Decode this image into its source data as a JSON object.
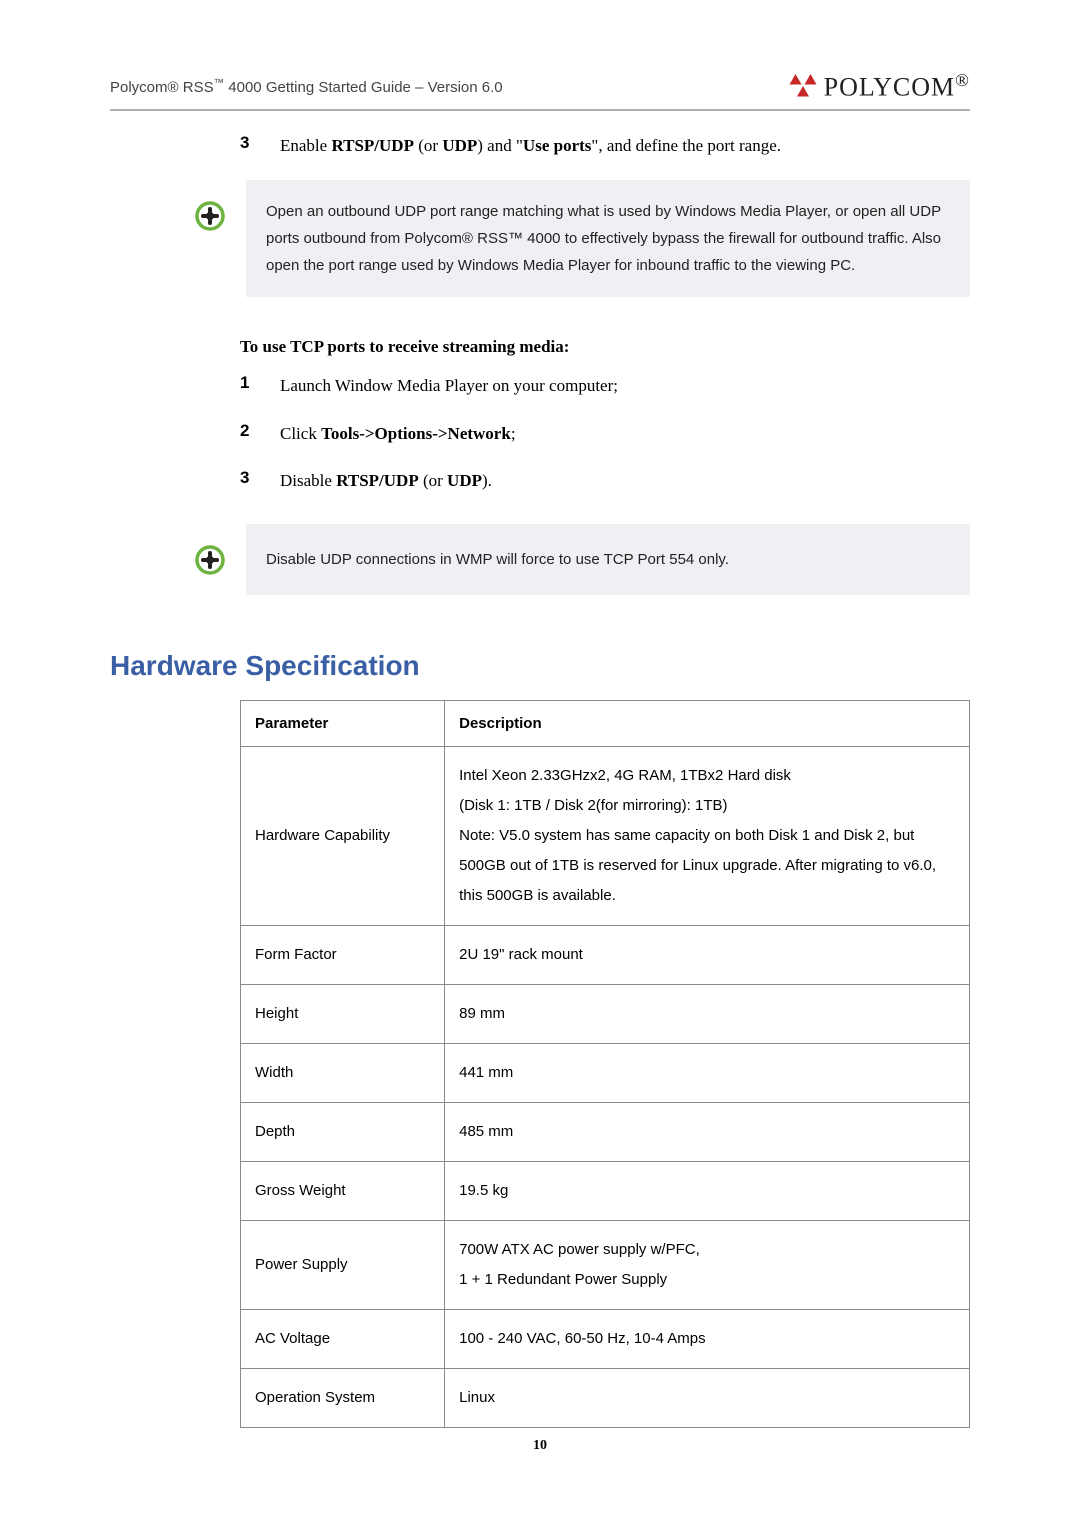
{
  "header": {
    "title_prefix": "Polycom",
    "title_reg": "®",
    "title_mid": " RSS",
    "title_tm": "™",
    "title_suffix": " 4000 Getting Started Guide – Version 6.0",
    "brand": "POLYCOM",
    "brand_reg": "®"
  },
  "step3": {
    "num": "3",
    "pre": "Enable ",
    "b1": "RTSP/UDP",
    "mid1": " (or ",
    "b2": "UDP",
    "mid2": ") and \"",
    "b3": "Use ports",
    "tail": "\", and define the port range."
  },
  "note1": "Open an outbound UDP port range matching what is used by Windows Media Player, or open all UDP ports outbound from Polycom® RSS™ 4000 to effectively bypass the firewall for outbound traffic. Also open the port range used by Windows Media Player for inbound traffic to the viewing PC.",
  "tcp_heading": "To use TCP ports to receive streaming media:",
  "tcp_steps": {
    "s1_num": "1",
    "s1_text": "Launch Window Media Player on your computer;",
    "s2_num": "2",
    "s2_pre": "Click ",
    "s2_bold": "Tools->Options->Network",
    "s2_tail": ";",
    "s3_num": "3",
    "s3_pre": "Disable ",
    "s3_b1": "RTSP/UDP",
    "s3_mid": " (or ",
    "s3_b2": "UDP",
    "s3_tail": ")."
  },
  "note2": "Disable UDP connections in WMP will force to use TCP Port 554 only.",
  "section_title": "Hardware Specification",
  "table": {
    "h1": "Parameter",
    "h2": "Description",
    "rows": [
      {
        "param": "Hardware Capability",
        "desc": "Intel Xeon 2.33GHzx2, 4G RAM, 1TBx2 Hard disk\n(Disk 1: 1TB / Disk 2(for mirroring): 1TB)\nNote: V5.0 system has same capacity on both Disk 1 and Disk 2, but 500GB out of 1TB is reserved for Linux upgrade. After migrating to v6.0, this 500GB is available."
      },
      {
        "param": "Form Factor",
        "desc": "2U 19\" rack mount"
      },
      {
        "param": "Height",
        "desc": "89 mm"
      },
      {
        "param": "Width",
        "desc": "441 mm"
      },
      {
        "param": "Depth",
        "desc": "485 mm"
      },
      {
        "param": "Gross Weight",
        "desc": "19.5 kg"
      },
      {
        "param": "Power Supply",
        "desc": "700W ATX AC power supply w/PFC,\n1 + 1 Redundant Power Supply"
      },
      {
        "param": "AC Voltage",
        "desc": "100 - 240 VAC, 60-50 Hz, 10-4 Amps"
      },
      {
        "param": "Operation System",
        "desc": "Linux"
      }
    ]
  },
  "page_number": "10",
  "chart_data": {
    "type": "table",
    "title": "Hardware Specification",
    "columns": [
      "Parameter",
      "Description"
    ],
    "rows": [
      [
        "Hardware Capability",
        "Intel Xeon 2.33GHzx2, 4G RAM, 1TBx2 Hard disk (Disk 1: 1TB / Disk 2(for mirroring): 1TB). Note: V5.0 system has same capacity on both Disk 1 and Disk 2, but 500GB out of 1TB is reserved for Linux upgrade. After migrating to v6.0, this 500GB is available."
      ],
      [
        "Form Factor",
        "2U 19\" rack mount"
      ],
      [
        "Height",
        "89 mm"
      ],
      [
        "Width",
        "441 mm"
      ],
      [
        "Depth",
        "485 mm"
      ],
      [
        "Gross Weight",
        "19.5 kg"
      ],
      [
        "Power Supply",
        "700W ATX AC power supply w/PFC, 1 + 1 Redundant Power Supply"
      ],
      [
        "AC Voltage",
        "100 - 240 VAC, 60-50 Hz, 10-4 Amps"
      ],
      [
        "Operation System",
        "Linux"
      ]
    ]
  }
}
